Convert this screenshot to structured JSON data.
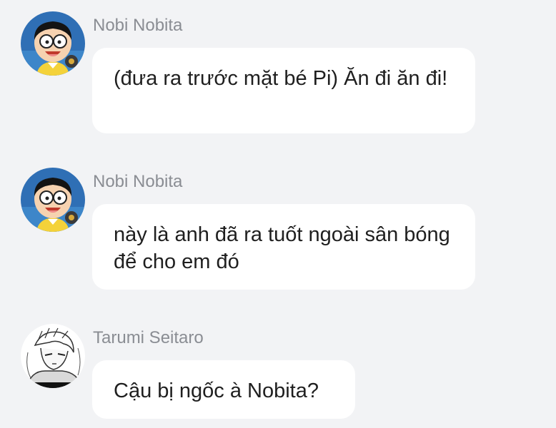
{
  "messages": [
    {
      "sender": "Nobi Nobita",
      "avatar_icon": "nobita-avatar-icon",
      "text": "(đưa ra trước mặt bé Pi) Ăn đi ăn đi!"
    },
    {
      "sender": "Nobi Nobita",
      "avatar_icon": "nobita-avatar-icon",
      "text": "này là anh đã ra tuốt ngoài sân bóng để cho em đó"
    },
    {
      "sender": "Tarumi Seitaro",
      "avatar_icon": "tarumi-avatar-icon",
      "text": "Cậu bị ngốc à Nobita?"
    }
  ],
  "colors": {
    "background": "#f2f3f5",
    "bubble": "#ffffff",
    "sender_name": "#8a8d93",
    "message_text": "#1f1f1f"
  }
}
